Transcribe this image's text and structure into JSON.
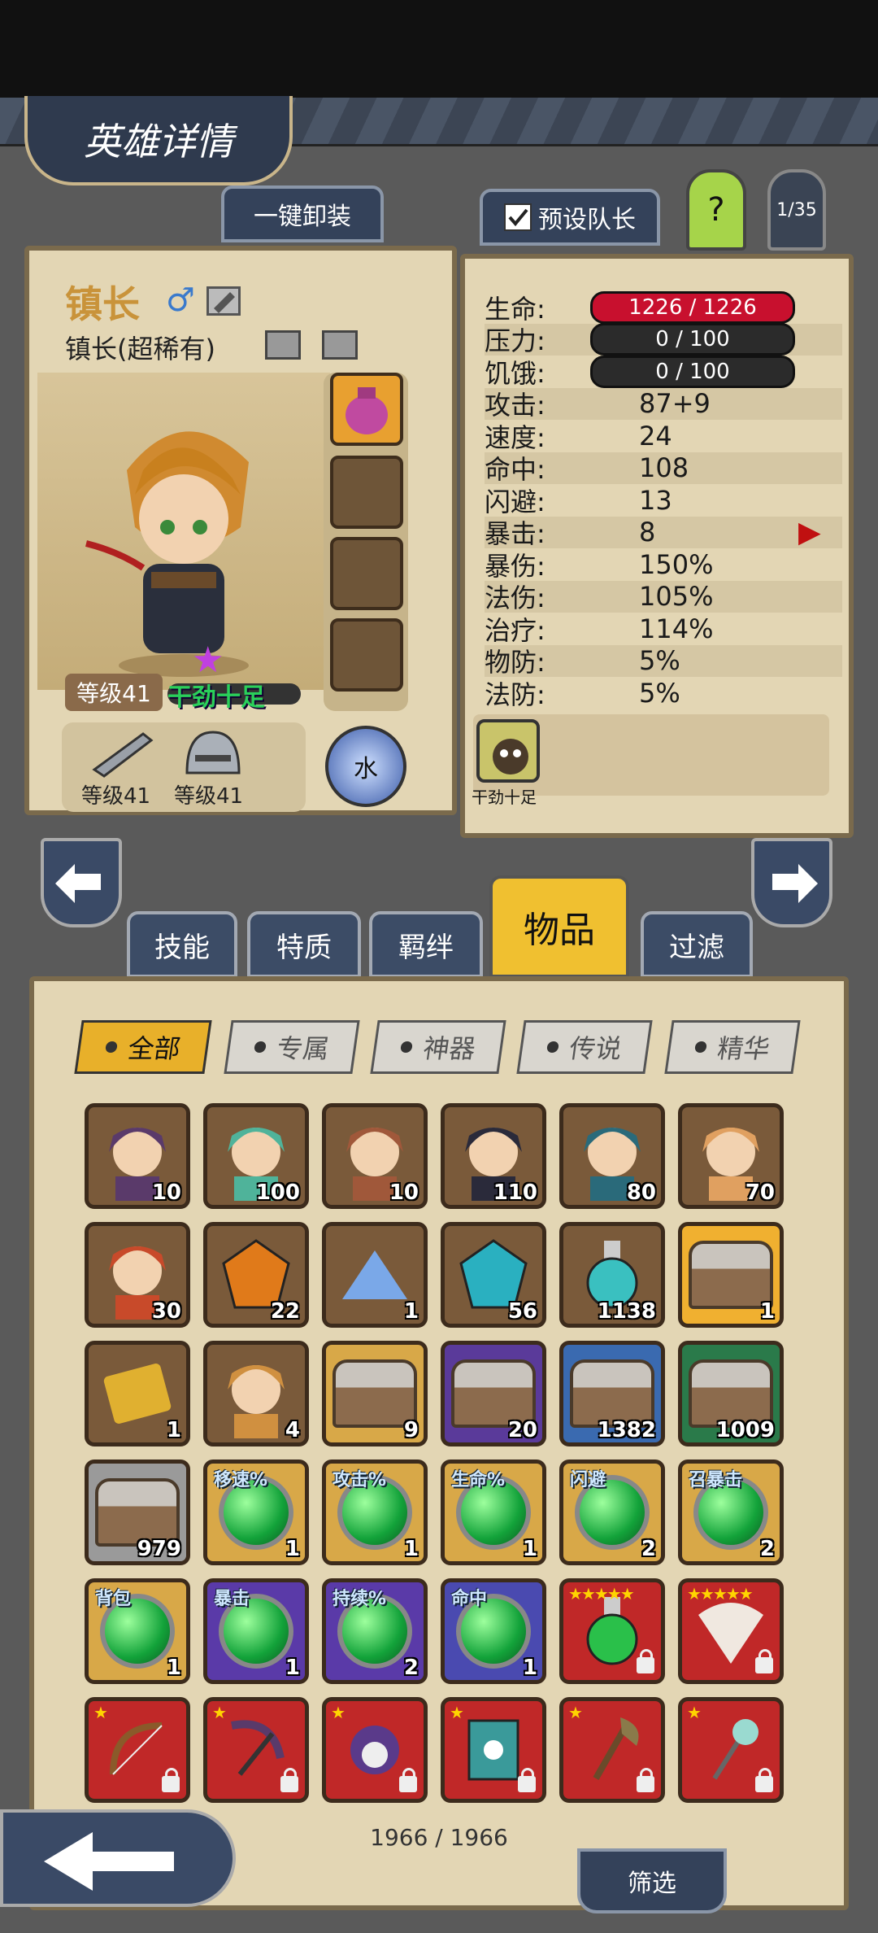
{
  "header": {
    "title": "英雄详情",
    "unequip_label": "一键卸装",
    "preset_leader_label": "预设队长",
    "help_label": "?",
    "page_counter": "1/35"
  },
  "hero": {
    "name": "镇长",
    "subtitle": "镇长(超稀有)",
    "level_label": "等级41",
    "trait_label": "干劲十足",
    "weapon_level": "等级41",
    "armor_level": "等级41",
    "element": "水",
    "status_icon_label": "干劲十足"
  },
  "stats": [
    {
      "label": "生命:",
      "value": "1226 / 1226",
      "kind": "bar",
      "color": "#c8102e"
    },
    {
      "label": "压力:",
      "value": "0 / 100",
      "kind": "bar",
      "color": "#2b2b2b"
    },
    {
      "label": "饥饿:",
      "value": "0 / 100",
      "kind": "bar",
      "color": "#2b2b2b"
    },
    {
      "label": "攻击:",
      "value": "87+9"
    },
    {
      "label": "速度:",
      "value": "24"
    },
    {
      "label": "命中:",
      "value": "108"
    },
    {
      "label": "闪避:",
      "value": "13"
    },
    {
      "label": "暴击:",
      "value": "8"
    },
    {
      "label": "暴伤:",
      "value": "150%"
    },
    {
      "label": "法伤:",
      "value": "105%"
    },
    {
      "label": "治疗:",
      "value": "114%"
    },
    {
      "label": "物防:",
      "value": "5%"
    },
    {
      "label": "法防:",
      "value": "5%"
    }
  ],
  "tabs": [
    "技能",
    "特质",
    "羁绊",
    "物品",
    "过滤"
  ],
  "filters": [
    "全部",
    "专属",
    "神器",
    "传说",
    "精华"
  ],
  "items": [
    {
      "count": "10",
      "bg": "#7a5a3a",
      "kind": "face",
      "tint": "#5a3a6a"
    },
    {
      "count": "100",
      "bg": "#7a5a3a",
      "kind": "face",
      "tint": "#4fb39a"
    },
    {
      "count": "10",
      "bg": "#7a5a3a",
      "kind": "face",
      "tint": "#a0583a"
    },
    {
      "count": "110",
      "bg": "#7a5a3a",
      "kind": "face",
      "tint": "#2a2a3a"
    },
    {
      "count": "80",
      "bg": "#7a5a3a",
      "kind": "face",
      "tint": "#2a6a7a"
    },
    {
      "count": "70",
      "bg": "#7a5a3a",
      "kind": "face",
      "tint": "#e0a060"
    },
    {
      "count": "30",
      "bg": "#7a5a3a",
      "kind": "face",
      "tint": "#c84a2a"
    },
    {
      "count": "22",
      "bg": "#7a5a3a",
      "kind": "gem",
      "tint": "#e07a1a"
    },
    {
      "count": "1",
      "bg": "#7a5a3a",
      "kind": "pile",
      "tint": "#7aa8e8"
    },
    {
      "count": "56",
      "bg": "#7a5a3a",
      "kind": "gem",
      "tint": "#2ab0c0"
    },
    {
      "count": "1138",
      "bg": "#7a5a3a",
      "kind": "potion",
      "tint": "#3ac0c0"
    },
    {
      "count": "1",
      "bg": "#f0b030",
      "kind": "chest",
      "tint": "#c9a050"
    },
    {
      "count": "1",
      "bg": "#7a5a3a",
      "kind": "ticket",
      "tint": "#e0b030"
    },
    {
      "count": "4",
      "bg": "#7a5a3a",
      "kind": "face",
      "tint": "#d09040"
    },
    {
      "count": "9",
      "bg": "#d8a848",
      "kind": "chest",
      "tint": "#c9a050"
    },
    {
      "count": "20",
      "bg": "#5a3a9a",
      "kind": "chest",
      "tint": "#c9a050"
    },
    {
      "count": "1382",
      "bg": "#3a6ab0",
      "kind": "chest",
      "tint": "#c9a050"
    },
    {
      "count": "1009",
      "bg": "#2a7a4a",
      "kind": "chest",
      "tint": "#c9a050"
    },
    {
      "count": "979",
      "bg": "#9a9a9a",
      "kind": "chest",
      "tint": "#c9a050"
    },
    {
      "count": "1",
      "bg": "#d8a848",
      "kind": "orb",
      "tag": "移速%"
    },
    {
      "count": "1",
      "bg": "#d8a848",
      "kind": "orb",
      "tag": "攻击%"
    },
    {
      "count": "1",
      "bg": "#d8a848",
      "kind": "orb",
      "tag": "生命%"
    },
    {
      "count": "2",
      "bg": "#d8a848",
      "kind": "orb",
      "tag": "闪避"
    },
    {
      "count": "2",
      "bg": "#d8a848",
      "kind": "orb",
      "tag": "召暴击"
    },
    {
      "count": "1",
      "bg": "#d8a848",
      "kind": "orb",
      "tag": "背包"
    },
    {
      "count": "1",
      "bg": "#5a3aa8",
      "kind": "orb",
      "tag": "暴击"
    },
    {
      "count": "2",
      "bg": "#5a3aa8",
      "kind": "orb",
      "tag": "持续%"
    },
    {
      "count": "1",
      "bg": "#4a4ab0",
      "kind": "orb",
      "tag": "命中"
    },
    {
      "count": "",
      "bg": "#c02828",
      "kind": "potion",
      "tint": "#2ac04a",
      "stars": "★★★★★",
      "lock": true
    },
    {
      "count": "",
      "bg": "#c02828",
      "kind": "fan",
      "tint": "#f0e8e0",
      "stars": "★★★★★",
      "lock": true
    },
    {
      "count": "",
      "bg": "#c02828",
      "kind": "bow",
      "tint": "#8a5a2a",
      "stars": "★",
      "lock": true
    },
    {
      "count": "",
      "bg": "#c02828",
      "kind": "scythe",
      "tint": "#5a3a6a",
      "stars": "★",
      "lock": true
    },
    {
      "count": "",
      "bg": "#c02828",
      "kind": "skull",
      "tint": "#5a3a8a",
      "stars": "★",
      "lock": true
    },
    {
      "count": "",
      "bg": "#c02828",
      "kind": "book",
      "tint": "#3a9a9a",
      "stars": "★",
      "lock": true
    },
    {
      "count": "",
      "bg": "#c02828",
      "kind": "axe",
      "tint": "#8a7a4a",
      "stars": "★",
      "lock": true
    },
    {
      "count": "",
      "bg": "#c02828",
      "kind": "staff",
      "tint": "#9adad0",
      "stars": "★",
      "lock": true
    }
  ],
  "footer": {
    "inventory_count": "1966 / 1966",
    "sort_label": "筛选"
  }
}
